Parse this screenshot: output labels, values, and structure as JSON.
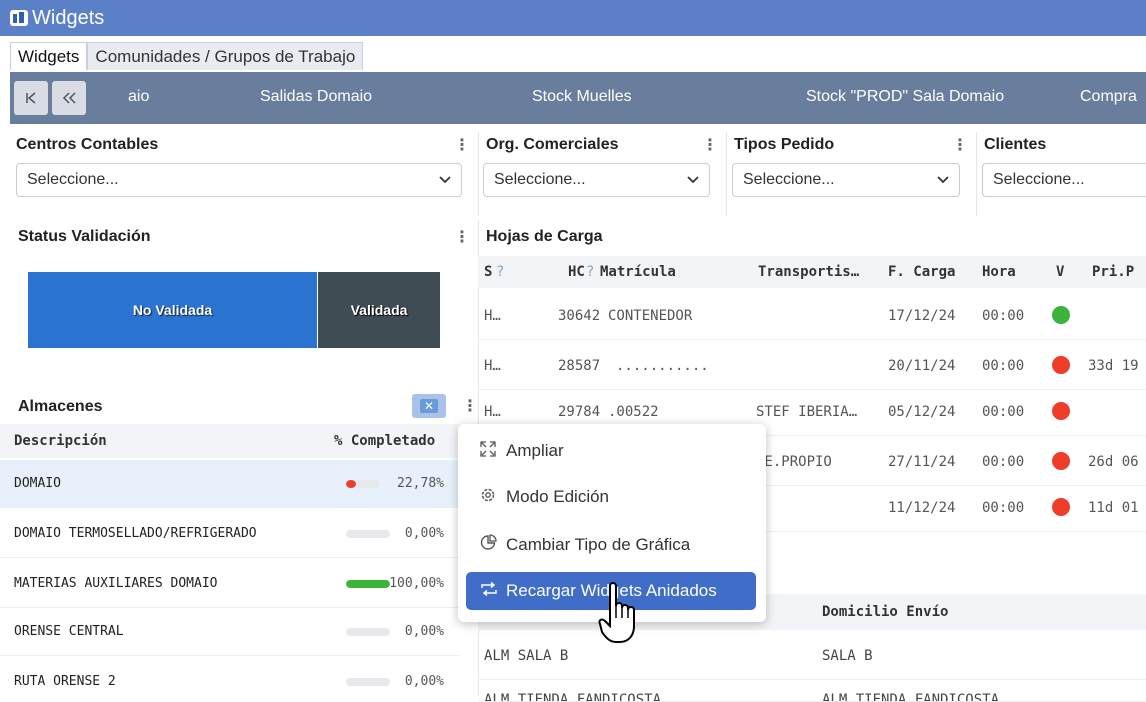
{
  "window": {
    "title": "Widgets"
  },
  "tabs": [
    "Widgets",
    "Comunidades / Grupos de Trabajo"
  ],
  "navbar": {
    "items": [
      "aio",
      "Salidas Domaio",
      "Stock Muelles",
      "Stock \"PROD\" Sala Domaio",
      "Compra"
    ]
  },
  "filters": [
    {
      "label": "Centros Contables",
      "placeholder": "Seleccione..."
    },
    {
      "label": "Org. Comerciales",
      "placeholder": "Seleccione..."
    },
    {
      "label": "Tipos Pedido",
      "placeholder": "Seleccione..."
    },
    {
      "label": "Clientes",
      "placeholder": "Seleccione..."
    }
  ],
  "status_validacion": {
    "title": "Status Validación",
    "segments": [
      {
        "label": "No Validada",
        "color": "#2a73d0"
      },
      {
        "label": "Validada",
        "color": "#3f4c54"
      }
    ]
  },
  "almacenes": {
    "title": "Almacenes",
    "columns": [
      "Descripción",
      "% Completado"
    ],
    "rows": [
      {
        "desc": "DOMAIO",
        "pct": "22,78%",
        "fraction": 0.2278,
        "color": "#f03c28"
      },
      {
        "desc": "DOMAIO TERMOSELLADO/REFRIGERADO",
        "pct": "0,00%",
        "fraction": 0,
        "color": "#e6e8ec"
      },
      {
        "desc": "MATERIAS AUXILIARES DOMAIO",
        "pct": "100,00%",
        "fraction": 1,
        "color": "#3cb43c"
      },
      {
        "desc": "ORENSE CENTRAL",
        "pct": "0,00%",
        "fraction": 0,
        "color": "#e6e8ec"
      },
      {
        "desc": "RUTA ORENSE 2",
        "pct": "0,00%",
        "fraction": 0,
        "color": "#e6e8ec"
      }
    ]
  },
  "hojas_carga": {
    "title": "Hojas de Carga",
    "columns": [
      "S",
      "HC",
      "Matrícula",
      "Transportis…",
      "F. Carga",
      "Hora",
      "V",
      "Pri.P"
    ],
    "rows": [
      {
        "s": "H…",
        "hc": "30642",
        "matricula": "CONTENEDOR",
        "transportista": "",
        "fecha": "17/12/24",
        "hora": "00:00",
        "status": "green",
        "pri": ""
      },
      {
        "s": "H…",
        "hc": "28587",
        "matricula": "...........",
        "transportista": "",
        "fecha": "20/11/24",
        "hora": "00:00",
        "status": "red",
        "pri": "33d 19"
      },
      {
        "s": "H…",
        "hc": "29784",
        "matricula": ".00522",
        "transportista": "STEF IBERIA…",
        "fecha": "05/12/24",
        "hora": "00:00",
        "status": "red",
        "pri": ""
      },
      {
        "s": "",
        "hc": "",
        "matricula": "",
        "transportista": "TE.PROPIO",
        "fecha": "27/11/24",
        "hora": "00:00",
        "status": "red",
        "pri": "26d 06"
      },
      {
        "s": "",
        "hc": "",
        "matricula": "",
        "transportista": "",
        "fecha": "11/12/24",
        "hora": "00:00",
        "status": "red",
        "pri": "11d 01"
      }
    ]
  },
  "bottom_table": {
    "columns": [
      "Domicilio Envío"
    ],
    "rows": [
      {
        "almacen": "ALM SALA B",
        "domicilio": "SALA B"
      },
      {
        "almacen": "ALM TIENDA FANDICOSTA",
        "domicilio": "ALM TIENDA FANDICOSTA"
      }
    ]
  },
  "context_menu": {
    "items": [
      {
        "label": "Ampliar",
        "icon": "expand-icon"
      },
      {
        "label": "Modo Edición",
        "icon": "gear-icon"
      },
      {
        "label": "Cambiar Tipo de Gráfica",
        "icon": "pie-chart-icon"
      },
      {
        "label": "Recargar Widgets Anidados",
        "icon": "reload-icon"
      }
    ]
  }
}
